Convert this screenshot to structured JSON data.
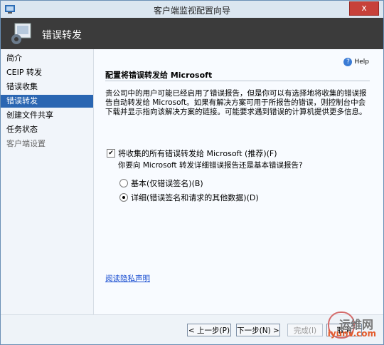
{
  "window": {
    "title": "客户端监视配置向导",
    "close_label": "x"
  },
  "banner": {
    "title": "错误转发"
  },
  "sidebar": {
    "items": [
      {
        "label": "简介"
      },
      {
        "label": "CEIP 转发"
      },
      {
        "label": "错误收集"
      },
      {
        "label": "错误转发"
      },
      {
        "label": "创建文件共享"
      },
      {
        "label": "任务状态"
      },
      {
        "label": "客户端设置"
      }
    ],
    "selected_index": 3
  },
  "main": {
    "help_label": "Help",
    "heading": "配置将错误转发给 Microsoft",
    "paragraph": "贵公司中的用户可能已经启用了错误报告，但是你可以有选择地将收集的错误报告自动转发给 Microsoft。如果有解决方案可用于所报告的错误，则控制台中会下载并显示指向该解决方案的链接。可能要求遇到错误的计算机提供更多信息。",
    "forward_checkbox": {
      "label": "将收集的所有错误转发给 Microsoft (推荐)(F)",
      "checked": true
    },
    "question": "你要向 Microsoft 转发详细错误报告还是基本错误报告?",
    "radio_basic": {
      "label": "基本(仅错误签名)(B)",
      "selected": false
    },
    "radio_detailed": {
      "label": "详细(错误签名和请求的其他数据)(D)",
      "selected": true
    },
    "privacy_link": "阅读隐私声明"
  },
  "footer": {
    "back": "< 上一步(P)",
    "next": "下一步(N) >",
    "finish": "完成(I)",
    "cancel": "取消"
  },
  "watermark": {
    "line1": "运维网",
    "line2": "iyunv.com"
  }
}
